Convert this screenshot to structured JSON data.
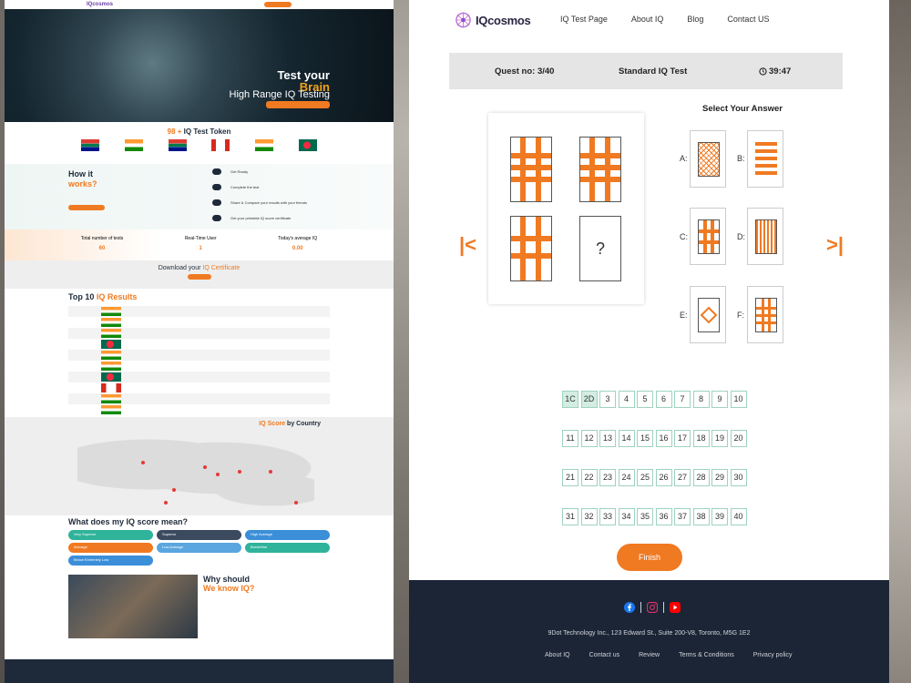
{
  "colors": {
    "accent": "#f07a22",
    "navy": "#1b2535",
    "answered": "#d3ede3",
    "grid_border": "#9ed3bd"
  },
  "left_page": {
    "brand": "IQcosmos",
    "hero": {
      "line1": "Test your",
      "line2": "Brain",
      "line3": "High Range IQ Testing"
    },
    "token_title_num": "98 +",
    "token_title": "IQ Test Token",
    "how": {
      "title": "How it",
      "title2": "works?"
    },
    "steps": [
      "Get Ready",
      "Complete the test",
      "Share & Compare your results with your friends",
      "Get your printable IQ score certificate"
    ],
    "stats": [
      {
        "label": "Total number of tests",
        "value": "60"
      },
      {
        "label": "Real-Time User",
        "value": "1"
      },
      {
        "label": "Today's average IQ",
        "value": "0.00"
      }
    ],
    "cert": {
      "text": "Download your",
      "highlight": "IQ Certificate"
    },
    "top10": {
      "text": "Top 10",
      "highlight": "IQ Results"
    },
    "map": {
      "highlight": "IQ Score",
      "text": "by Country"
    },
    "score_title": "What does my IQ score mean?",
    "pills": [
      {
        "label": "Very Superior",
        "color": "#2fb39a"
      },
      {
        "label": "Superior",
        "color": "#3b4a5e"
      },
      {
        "label": "High Average",
        "color": "#3b8fd9"
      },
      {
        "label": "Average",
        "color": "#f07a22"
      },
      {
        "label": "Low Average",
        "color": "#5aa6e0"
      },
      {
        "label": "Borderline",
        "color": "#2fb39a"
      },
      {
        "label": "Below Extremely Low",
        "color": "#3b8fd9"
      }
    ],
    "why": {
      "text": "Why should",
      "highlight": "We know IQ?"
    }
  },
  "header": {
    "brand": "IQcosmos",
    "nav": [
      "IQ Test Page",
      "About IQ",
      "Blog",
      "Contact US"
    ]
  },
  "question_bar": {
    "question": "Quest no: 3/40",
    "title": "Standard IQ Test",
    "time": "39:47"
  },
  "answers": {
    "title": "Select Your Answer",
    "labels": [
      "A:",
      "B:",
      "C:",
      "D:",
      "E:",
      "F:"
    ]
  },
  "question_mark": "?",
  "questions": [
    {
      "n": "1C",
      "done": true
    },
    {
      "n": "2D",
      "done": true
    },
    {
      "n": "3"
    },
    {
      "n": "4"
    },
    {
      "n": "5"
    },
    {
      "n": "6"
    },
    {
      "n": "7"
    },
    {
      "n": "8"
    },
    {
      "n": "9"
    },
    {
      "n": "10"
    },
    {
      "n": "11"
    },
    {
      "n": "12"
    },
    {
      "n": "13"
    },
    {
      "n": "14"
    },
    {
      "n": "15"
    },
    {
      "n": "16"
    },
    {
      "n": "17"
    },
    {
      "n": "18"
    },
    {
      "n": "19"
    },
    {
      "n": "20"
    },
    {
      "n": "21"
    },
    {
      "n": "22"
    },
    {
      "n": "23"
    },
    {
      "n": "24"
    },
    {
      "n": "25"
    },
    {
      "n": "26"
    },
    {
      "n": "27"
    },
    {
      "n": "28"
    },
    {
      "n": "29"
    },
    {
      "n": "30"
    },
    {
      "n": "31"
    },
    {
      "n": "32"
    },
    {
      "n": "33"
    },
    {
      "n": "34"
    },
    {
      "n": "35"
    },
    {
      "n": "36"
    },
    {
      "n": "37"
    },
    {
      "n": "38"
    },
    {
      "n": "39"
    },
    {
      "n": "40"
    }
  ],
  "finish_label": "Finish",
  "footer": {
    "address": "9Dot Technology Inc., 123 Edward St., Suite 200-V8, Toronto, M5G 1E2",
    "links": [
      "About IQ",
      "Contact us",
      "Review",
      "Terms & Conditions",
      "Privacy policy"
    ]
  }
}
